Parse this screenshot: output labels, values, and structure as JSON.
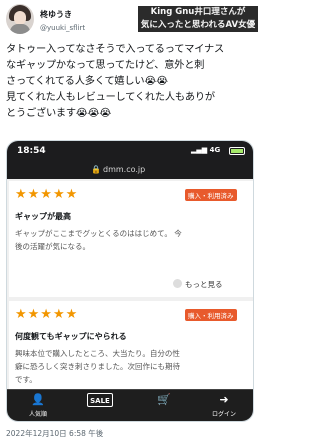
{
  "header": {
    "display_name": "柊ゆうき",
    "handle": "@yuuki_sflirt",
    "headline": "King Gnu井口理さんが\n気に入ったと思われるAV女優"
  },
  "tweet": {
    "lines": [
      "タトゥー入ってなさそうで入ってるってマイナス",
      "なギャップかなって思ってたけど、意外と刺",
      "さってくれてる人多くて嬉しい😭😭",
      "見てくれた人もレビューしてくれた人もありが",
      "とうございます😭😭😭"
    ]
  },
  "screenshot": {
    "status_time": "18:54",
    "status_network": "4G",
    "url": "dmm.co.jp",
    "reviews": [
      {
        "stars": "★★★★★",
        "badge": "購入・利用済み",
        "title": "ギャップが最高",
        "body_lines": [
          "ギャップがここまでグッとくるのははじめて。 今",
          "後の活躍が気になる。"
        ],
        "more_label": "もっと見る"
      },
      {
        "stars": "★★★★★",
        "badge": "購入・利用済み",
        "title": "何度観てもギャップにやられる",
        "body_lines": [
          "興味本位で購入したところ、大当たり。自分の性",
          "癖に恐ろしく突き刺さりました。次回作にも期待",
          "です。"
        ]
      }
    ],
    "nav": [
      {
        "icon": "person-icon",
        "label": "人気順"
      },
      {
        "icon": "sale-icon",
        "label": "SALE"
      },
      {
        "icon": "cart-icon",
        "label": ""
      },
      {
        "icon": "login-icon",
        "label": "ログイン"
      }
    ]
  },
  "timestamp": "2022年12月10日 6:58 午後"
}
